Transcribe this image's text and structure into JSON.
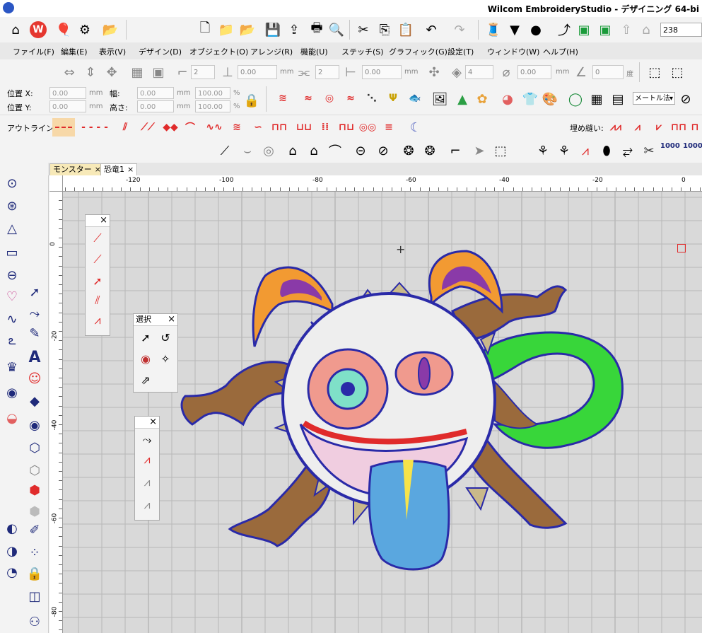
{
  "window": {
    "title": "Wilcom EmbroideryStudio - デザイニング 64-bi"
  },
  "menu": [
    "ファイル(F)",
    "編集(E)",
    "表示(V)",
    "デザイン(D)",
    "オブジェクト(O)",
    "アレンジ(R)",
    "機能(U)",
    "ステッチ(S)",
    "グラフィック(G)",
    "設定(T)",
    "ウィンドウ(W)",
    "ヘルプ(H)"
  ],
  "toolbar": {
    "zoom_value": "238"
  },
  "transform": {
    "spin_values": [
      "2",
      "0.00",
      "2",
      "0.00",
      "4",
      "0.00",
      "0"
    ],
    "unit_mm": "mm",
    "unit_deg": "度"
  },
  "properties": {
    "pos_x_label": "位置 X:",
    "pos_y_label": "位置 Y:",
    "width_label": "幅:",
    "height_label": "高さ:",
    "pos_x": "0.00",
    "pos_y": "0.00",
    "width": "0.00",
    "height": "0.00",
    "scale_w": "100.00",
    "scale_h": "100.00",
    "unit_mm": "mm",
    "unit_pct": "%",
    "measure_select": "メートル法"
  },
  "stitch_bar": {
    "outline_label": "アウトライン:",
    "fill_label": "埋め縫い:",
    "thousand_a": "1000",
    "thousand_b": "1000"
  },
  "tabs": [
    {
      "label": "モンスター",
      "close": "×",
      "active": true
    },
    {
      "label": "恐竜1",
      "close": "×",
      "active": false
    }
  ],
  "rulers": {
    "h_labels": [
      "-120",
      "-100",
      "-80",
      "-60",
      "-40",
      "-20",
      "0"
    ],
    "v_labels": [
      "0",
      "-20",
      "-40",
      "-60",
      "-80"
    ]
  },
  "palettes": {
    "select_title": "選択",
    "close": "×"
  },
  "colors": {
    "accent_red": "#e02b2b",
    "outline_blue": "#2a2aa8",
    "tongue_blue": "#5aa7df",
    "orange": "#f29a32",
    "green": "#38d63a",
    "brown": "#9a6a3c",
    "pink": "#f09a8e",
    "purple": "#8a3aa8"
  }
}
